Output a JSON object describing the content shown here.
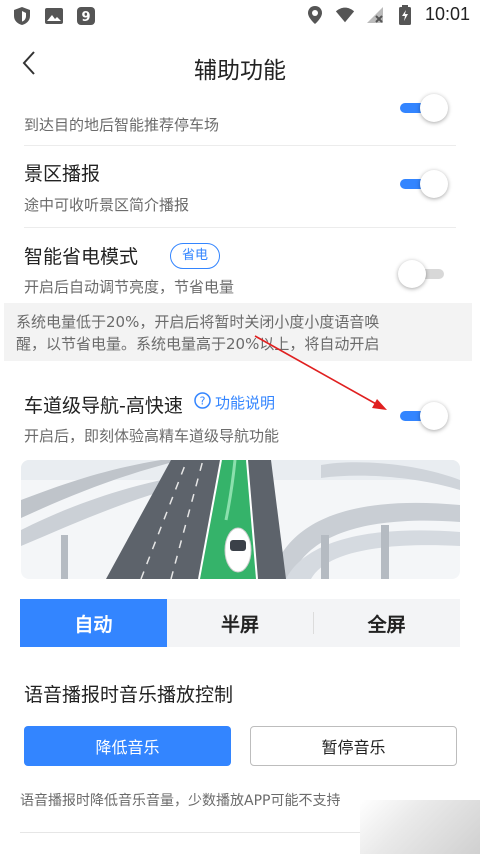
{
  "status_bar": {
    "time": "10:01",
    "left_icons": [
      "shield-icon",
      "image-icon",
      "app-9-icon"
    ],
    "right_icons": [
      "location-icon",
      "wifi-icon",
      "no-signal-icon",
      "battery-charging-icon"
    ]
  },
  "nav": {
    "title": "辅助功能",
    "back_icon": "back-chevron-icon"
  },
  "settings": {
    "parking": {
      "subtitle": "到达目的地后智能推荐停车场",
      "enabled": true
    },
    "scenic": {
      "title": "景区播报",
      "subtitle": "途中可收听景区简介播报",
      "enabled": true
    },
    "power_save": {
      "title": "智能省电模式",
      "badge": "省电",
      "subtitle": "开启后自动调节亮度，节省电量",
      "enabled": false,
      "notice_line1": "系统电量低于20%，开启后将暂时关闭小度小度语音唤",
      "notice_line2": "醒，以节省电量。系统电量高于20%以上，将自动开启"
    },
    "lane_nav": {
      "title": "车道级导航-高快速",
      "help_label": "功能说明",
      "subtitle": "开启后，即刻体验高精车道级导航功能",
      "enabled": true
    }
  },
  "display_mode": {
    "options": [
      "自动",
      "半屏",
      "全屏"
    ],
    "selected": "自动"
  },
  "music_control": {
    "title": "语音播报时音乐播放控制",
    "lower_label": "降低音乐",
    "pause_label": "暂停音乐",
    "selected": "降低音乐",
    "note": "语音播报时降低音乐音量，少数播放APP可能不支持"
  },
  "colors": {
    "accent": "#3385ff",
    "annotation_arrow": "#e02020"
  }
}
